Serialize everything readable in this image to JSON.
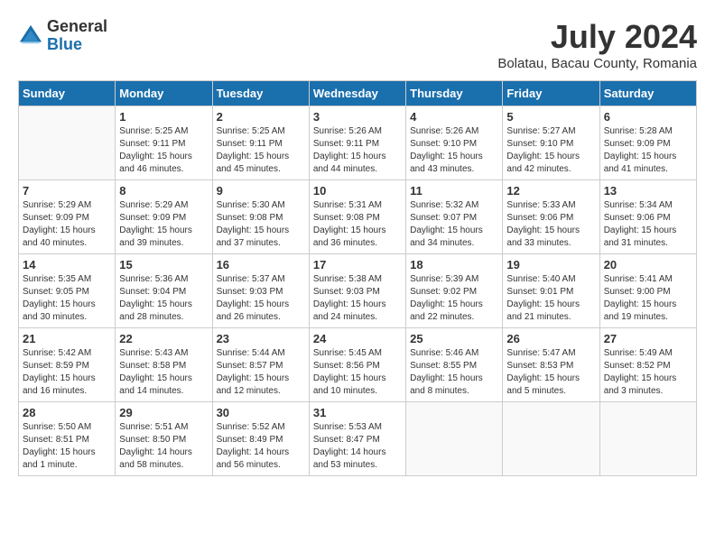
{
  "header": {
    "logo_general": "General",
    "logo_blue": "Blue",
    "month_year": "July 2024",
    "location": "Bolatau, Bacau County, Romania"
  },
  "days_of_week": [
    "Sunday",
    "Monday",
    "Tuesday",
    "Wednesday",
    "Thursday",
    "Friday",
    "Saturday"
  ],
  "weeks": [
    [
      {
        "day": "",
        "info": ""
      },
      {
        "day": "1",
        "info": "Sunrise: 5:25 AM\nSunset: 9:11 PM\nDaylight: 15 hours\nand 46 minutes."
      },
      {
        "day": "2",
        "info": "Sunrise: 5:25 AM\nSunset: 9:11 PM\nDaylight: 15 hours\nand 45 minutes."
      },
      {
        "day": "3",
        "info": "Sunrise: 5:26 AM\nSunset: 9:11 PM\nDaylight: 15 hours\nand 44 minutes."
      },
      {
        "day": "4",
        "info": "Sunrise: 5:26 AM\nSunset: 9:10 PM\nDaylight: 15 hours\nand 43 minutes."
      },
      {
        "day": "5",
        "info": "Sunrise: 5:27 AM\nSunset: 9:10 PM\nDaylight: 15 hours\nand 42 minutes."
      },
      {
        "day": "6",
        "info": "Sunrise: 5:28 AM\nSunset: 9:09 PM\nDaylight: 15 hours\nand 41 minutes."
      }
    ],
    [
      {
        "day": "7",
        "info": "Sunrise: 5:29 AM\nSunset: 9:09 PM\nDaylight: 15 hours\nand 40 minutes."
      },
      {
        "day": "8",
        "info": "Sunrise: 5:29 AM\nSunset: 9:09 PM\nDaylight: 15 hours\nand 39 minutes."
      },
      {
        "day": "9",
        "info": "Sunrise: 5:30 AM\nSunset: 9:08 PM\nDaylight: 15 hours\nand 37 minutes."
      },
      {
        "day": "10",
        "info": "Sunrise: 5:31 AM\nSunset: 9:08 PM\nDaylight: 15 hours\nand 36 minutes."
      },
      {
        "day": "11",
        "info": "Sunrise: 5:32 AM\nSunset: 9:07 PM\nDaylight: 15 hours\nand 34 minutes."
      },
      {
        "day": "12",
        "info": "Sunrise: 5:33 AM\nSunset: 9:06 PM\nDaylight: 15 hours\nand 33 minutes."
      },
      {
        "day": "13",
        "info": "Sunrise: 5:34 AM\nSunset: 9:06 PM\nDaylight: 15 hours\nand 31 minutes."
      }
    ],
    [
      {
        "day": "14",
        "info": "Sunrise: 5:35 AM\nSunset: 9:05 PM\nDaylight: 15 hours\nand 30 minutes."
      },
      {
        "day": "15",
        "info": "Sunrise: 5:36 AM\nSunset: 9:04 PM\nDaylight: 15 hours\nand 28 minutes."
      },
      {
        "day": "16",
        "info": "Sunrise: 5:37 AM\nSunset: 9:03 PM\nDaylight: 15 hours\nand 26 minutes."
      },
      {
        "day": "17",
        "info": "Sunrise: 5:38 AM\nSunset: 9:03 PM\nDaylight: 15 hours\nand 24 minutes."
      },
      {
        "day": "18",
        "info": "Sunrise: 5:39 AM\nSunset: 9:02 PM\nDaylight: 15 hours\nand 22 minutes."
      },
      {
        "day": "19",
        "info": "Sunrise: 5:40 AM\nSunset: 9:01 PM\nDaylight: 15 hours\nand 21 minutes."
      },
      {
        "day": "20",
        "info": "Sunrise: 5:41 AM\nSunset: 9:00 PM\nDaylight: 15 hours\nand 19 minutes."
      }
    ],
    [
      {
        "day": "21",
        "info": "Sunrise: 5:42 AM\nSunset: 8:59 PM\nDaylight: 15 hours\nand 16 minutes."
      },
      {
        "day": "22",
        "info": "Sunrise: 5:43 AM\nSunset: 8:58 PM\nDaylight: 15 hours\nand 14 minutes."
      },
      {
        "day": "23",
        "info": "Sunrise: 5:44 AM\nSunset: 8:57 PM\nDaylight: 15 hours\nand 12 minutes."
      },
      {
        "day": "24",
        "info": "Sunrise: 5:45 AM\nSunset: 8:56 PM\nDaylight: 15 hours\nand 10 minutes."
      },
      {
        "day": "25",
        "info": "Sunrise: 5:46 AM\nSunset: 8:55 PM\nDaylight: 15 hours\nand 8 minutes."
      },
      {
        "day": "26",
        "info": "Sunrise: 5:47 AM\nSunset: 8:53 PM\nDaylight: 15 hours\nand 5 minutes."
      },
      {
        "day": "27",
        "info": "Sunrise: 5:49 AM\nSunset: 8:52 PM\nDaylight: 15 hours\nand 3 minutes."
      }
    ],
    [
      {
        "day": "28",
        "info": "Sunrise: 5:50 AM\nSunset: 8:51 PM\nDaylight: 15 hours\nand 1 minute."
      },
      {
        "day": "29",
        "info": "Sunrise: 5:51 AM\nSunset: 8:50 PM\nDaylight: 14 hours\nand 58 minutes."
      },
      {
        "day": "30",
        "info": "Sunrise: 5:52 AM\nSunset: 8:49 PM\nDaylight: 14 hours\nand 56 minutes."
      },
      {
        "day": "31",
        "info": "Sunrise: 5:53 AM\nSunset: 8:47 PM\nDaylight: 14 hours\nand 53 minutes."
      },
      {
        "day": "",
        "info": ""
      },
      {
        "day": "",
        "info": ""
      },
      {
        "day": "",
        "info": ""
      }
    ]
  ]
}
